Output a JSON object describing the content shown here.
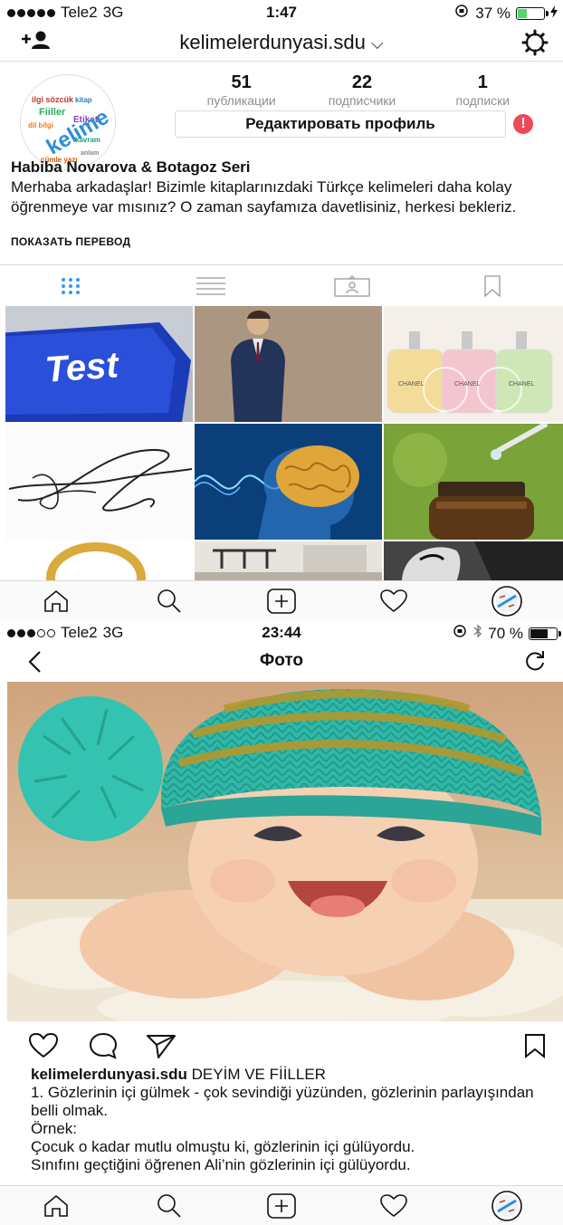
{
  "screen1": {
    "status": {
      "carrier": "Tele2",
      "network": "3G",
      "time": "1:47",
      "battery": "37 %",
      "battery_level": 0.37,
      "battery_color": "#4cd964"
    },
    "nav": {
      "username": "kelimelerdunyasi.sdu",
      "caret": "⌵"
    },
    "avatar_words": [
      "Fiiller",
      "Etiket",
      "kelime"
    ],
    "stats": [
      {
        "value": "51",
        "label": "публикации"
      },
      {
        "value": "22",
        "label": "подписчики"
      },
      {
        "value": "1",
        "label": "подписки"
      }
    ],
    "edit_profile": "Редактировать профиль",
    "alert": "!",
    "bio": {
      "name": "Habiba Novarova & Botagoz Seri",
      "text": "Merhaba arkadaşlar! Bizimle kitaplarınızdaki Türkçe kelimeleri daha kolay öğrenmeye var mısınız? O zaman sayfamıza davetlisiniz, herkesi bekleriz."
    },
    "translate": "ПОКАЗАТЬ ПЕРЕВОД",
    "grid": {
      "test_key": "Test",
      "perfume_label": "CHANEL"
    }
  },
  "screen2": {
    "status": {
      "carrier": "Tele2",
      "network": "3G",
      "time": "23:44",
      "battery": "70 %",
      "battery_level": 0.7,
      "battery_color": "#111111"
    },
    "nav": {
      "title": "Фото"
    },
    "caption": {
      "user": "kelimelerdunyasi.sdu",
      "heading": "DEYİM VE FİİLLER",
      "lines": [
        "1. Gözlerinin içi gülmek - çok sevindiği yüzünden, gözlerinin parlayışından belli olmak.",
        "Örnek:",
        "Çocuk o kadar mutlu olmuştu ki, gözlerinin içi gülüyordu.",
        "Sınıfını geçtiğini öğrenen Ali’nin gözlerinin içi gülüyordu."
      ]
    }
  },
  "colors": {
    "accent_blue": "#3897f0",
    "alert_red": "#ed4956",
    "border": "#dbdbdb",
    "muted": "#8e8e8e"
  }
}
